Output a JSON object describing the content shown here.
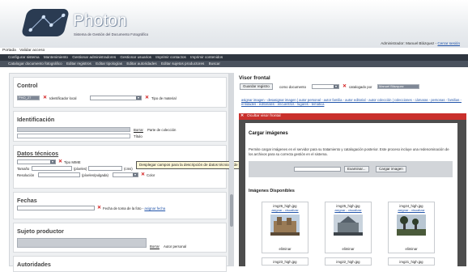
{
  "header": {
    "brand": "Photon",
    "subtitle": "Sistema de Gestión del Documento Fotográfico",
    "admin_prefix": "Administrador: Manuel Blázquez - ",
    "logout": "Cerrar sesión"
  },
  "topnav": {
    "item1": "Portada",
    "item2": "Validar acceso"
  },
  "menu1": [
    "Configurar sistema",
    "Mantenimiento",
    "Gestionar administradores",
    "Gestionar usuarios",
    "Imprimir contactos",
    "Imprimir contenidos"
  ],
  "menu2": [
    "Catalogar documento fotográfico",
    "Editar registros",
    "Editar tipologías",
    "Editar autoridades",
    "Editar sujetos productores",
    "Buscar"
  ],
  "control": {
    "title": "Control",
    "code_value": "PHO_27",
    "local_id_label": "Identificador local",
    "material_label": "Tipo de material"
  },
  "identificacion": {
    "title": "Identificación",
    "borrar": "Borrar",
    "parte_label": "Parte de colección",
    "titulo_label": "Título"
  },
  "datos": {
    "title": "Datos técnicos",
    "mime_label": "Tipo MIME",
    "tamano_label": "Tamaño",
    "pixeles_label": "(píxeles)",
    "cms_label": "(cms)",
    "resolucion_label": "Resolución",
    "ppp_label": "(píxeles/pulgada)",
    "color_label": "Color"
  },
  "tooltip": "Desplegar campos para la descripción de datos técnicos de la fotografía.",
  "fechas": {
    "title": "Fechas",
    "fecha_label": "Fecha de toma de la foto - ",
    "asignar_fecha": "asignar fecha"
  },
  "sujeto": {
    "title": "Sujeto productor",
    "borrar": "Borrar",
    "autor_label": "Autor personal"
  },
  "autoridades": {
    "title": "Autoridades"
  },
  "visor": {
    "title": "Visor frontal",
    "guardar": "Guardar registro",
    "como": "como documento",
    "catalogado": "catalogado por",
    "catalogador": "Manuel Blázquez",
    "links": "asignar imagen - desasignar imagen | autor personal - autor familia - autor editorial - autor colección | colecciones - cámaras - personas - familias - entidades - editoriales - encuentros - lugares - temática",
    "ocultar": "Ocultar visor frontal"
  },
  "cargar": {
    "title": "Cargar imágenes",
    "desc": "Permite cargar imágenes en el servidor para su tratamiento y catalogación posterior. Este proceso incluye una redenominación de los archivos para su correcta gestión en el sistema.",
    "examinar": "Examinar...",
    "cargar_btn": "Cargar imagen",
    "disponibles": "Imágenes Disponibles"
  },
  "images": [
    {
      "name": "img26_high.jpg",
      "links": "asignar - visualizar",
      "del": "eliminar"
    },
    {
      "name": "img25_high.jpg",
      "links": "asignar - visualizar",
      "del": "eliminar"
    },
    {
      "name": "img24_high.jpg",
      "links": "asignar - visualizar",
      "del": "eliminar"
    }
  ],
  "images_row2": [
    "img23_high.jpg",
    "img22_high.jpg",
    "img21_high.jpg"
  ]
}
